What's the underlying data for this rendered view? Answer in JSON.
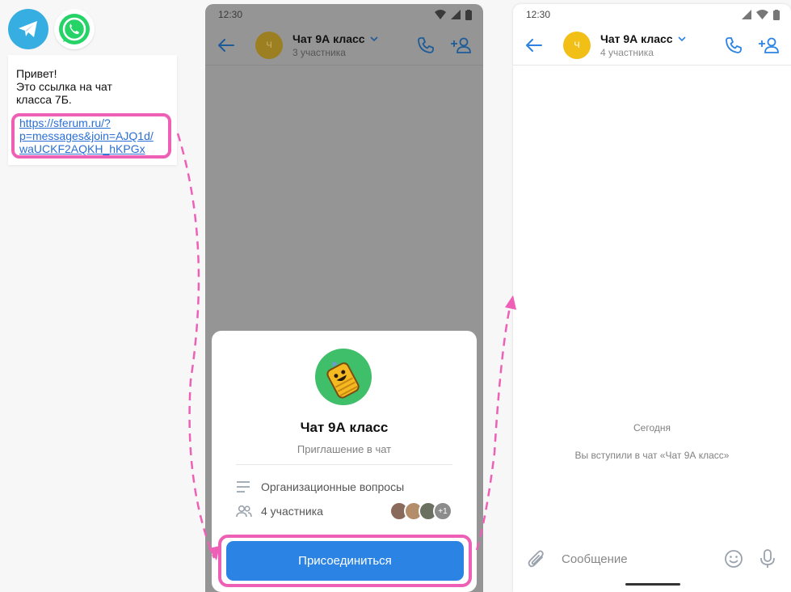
{
  "messengers": [
    {
      "name": "telegram-icon",
      "color": "#37aee2"
    },
    {
      "name": "whatsapp-icon",
      "color": "#25d366"
    }
  ],
  "message": {
    "lines": [
      "Привет!",
      "Это ссылка на чат",
      "класса 7Б."
    ],
    "link_lines": [
      "https://sferum.ru/?",
      "p=messages&join=AJQ1d/",
      "waUCKF2AQKH_hKPGx"
    ]
  },
  "invite_screen": {
    "status_time": "12:30",
    "chat_title": "Чат 9А класс",
    "chat_subtitle": "3 участника",
    "avatar_letter": "Ч",
    "sheet": {
      "title": "Чат 9А класс",
      "subtitle": "Приглашение в чат",
      "description": "Организационные вопросы",
      "members": "4 участника",
      "more_count": "+1",
      "join_label": "Присоединиться"
    }
  },
  "chat_screen": {
    "status_time": "12:30",
    "chat_title": "Чат 9А класс",
    "chat_subtitle": "4 участника",
    "avatar_letter": "Ч",
    "date_separator": "Сегодня",
    "system_message": "Вы вступили в чат «Чат 9А класс»",
    "composer_placeholder": "Сообщение"
  },
  "colors": {
    "accent": "#2b84e4",
    "highlight": "#ee5fb6",
    "avatar": "#f2bf16"
  }
}
